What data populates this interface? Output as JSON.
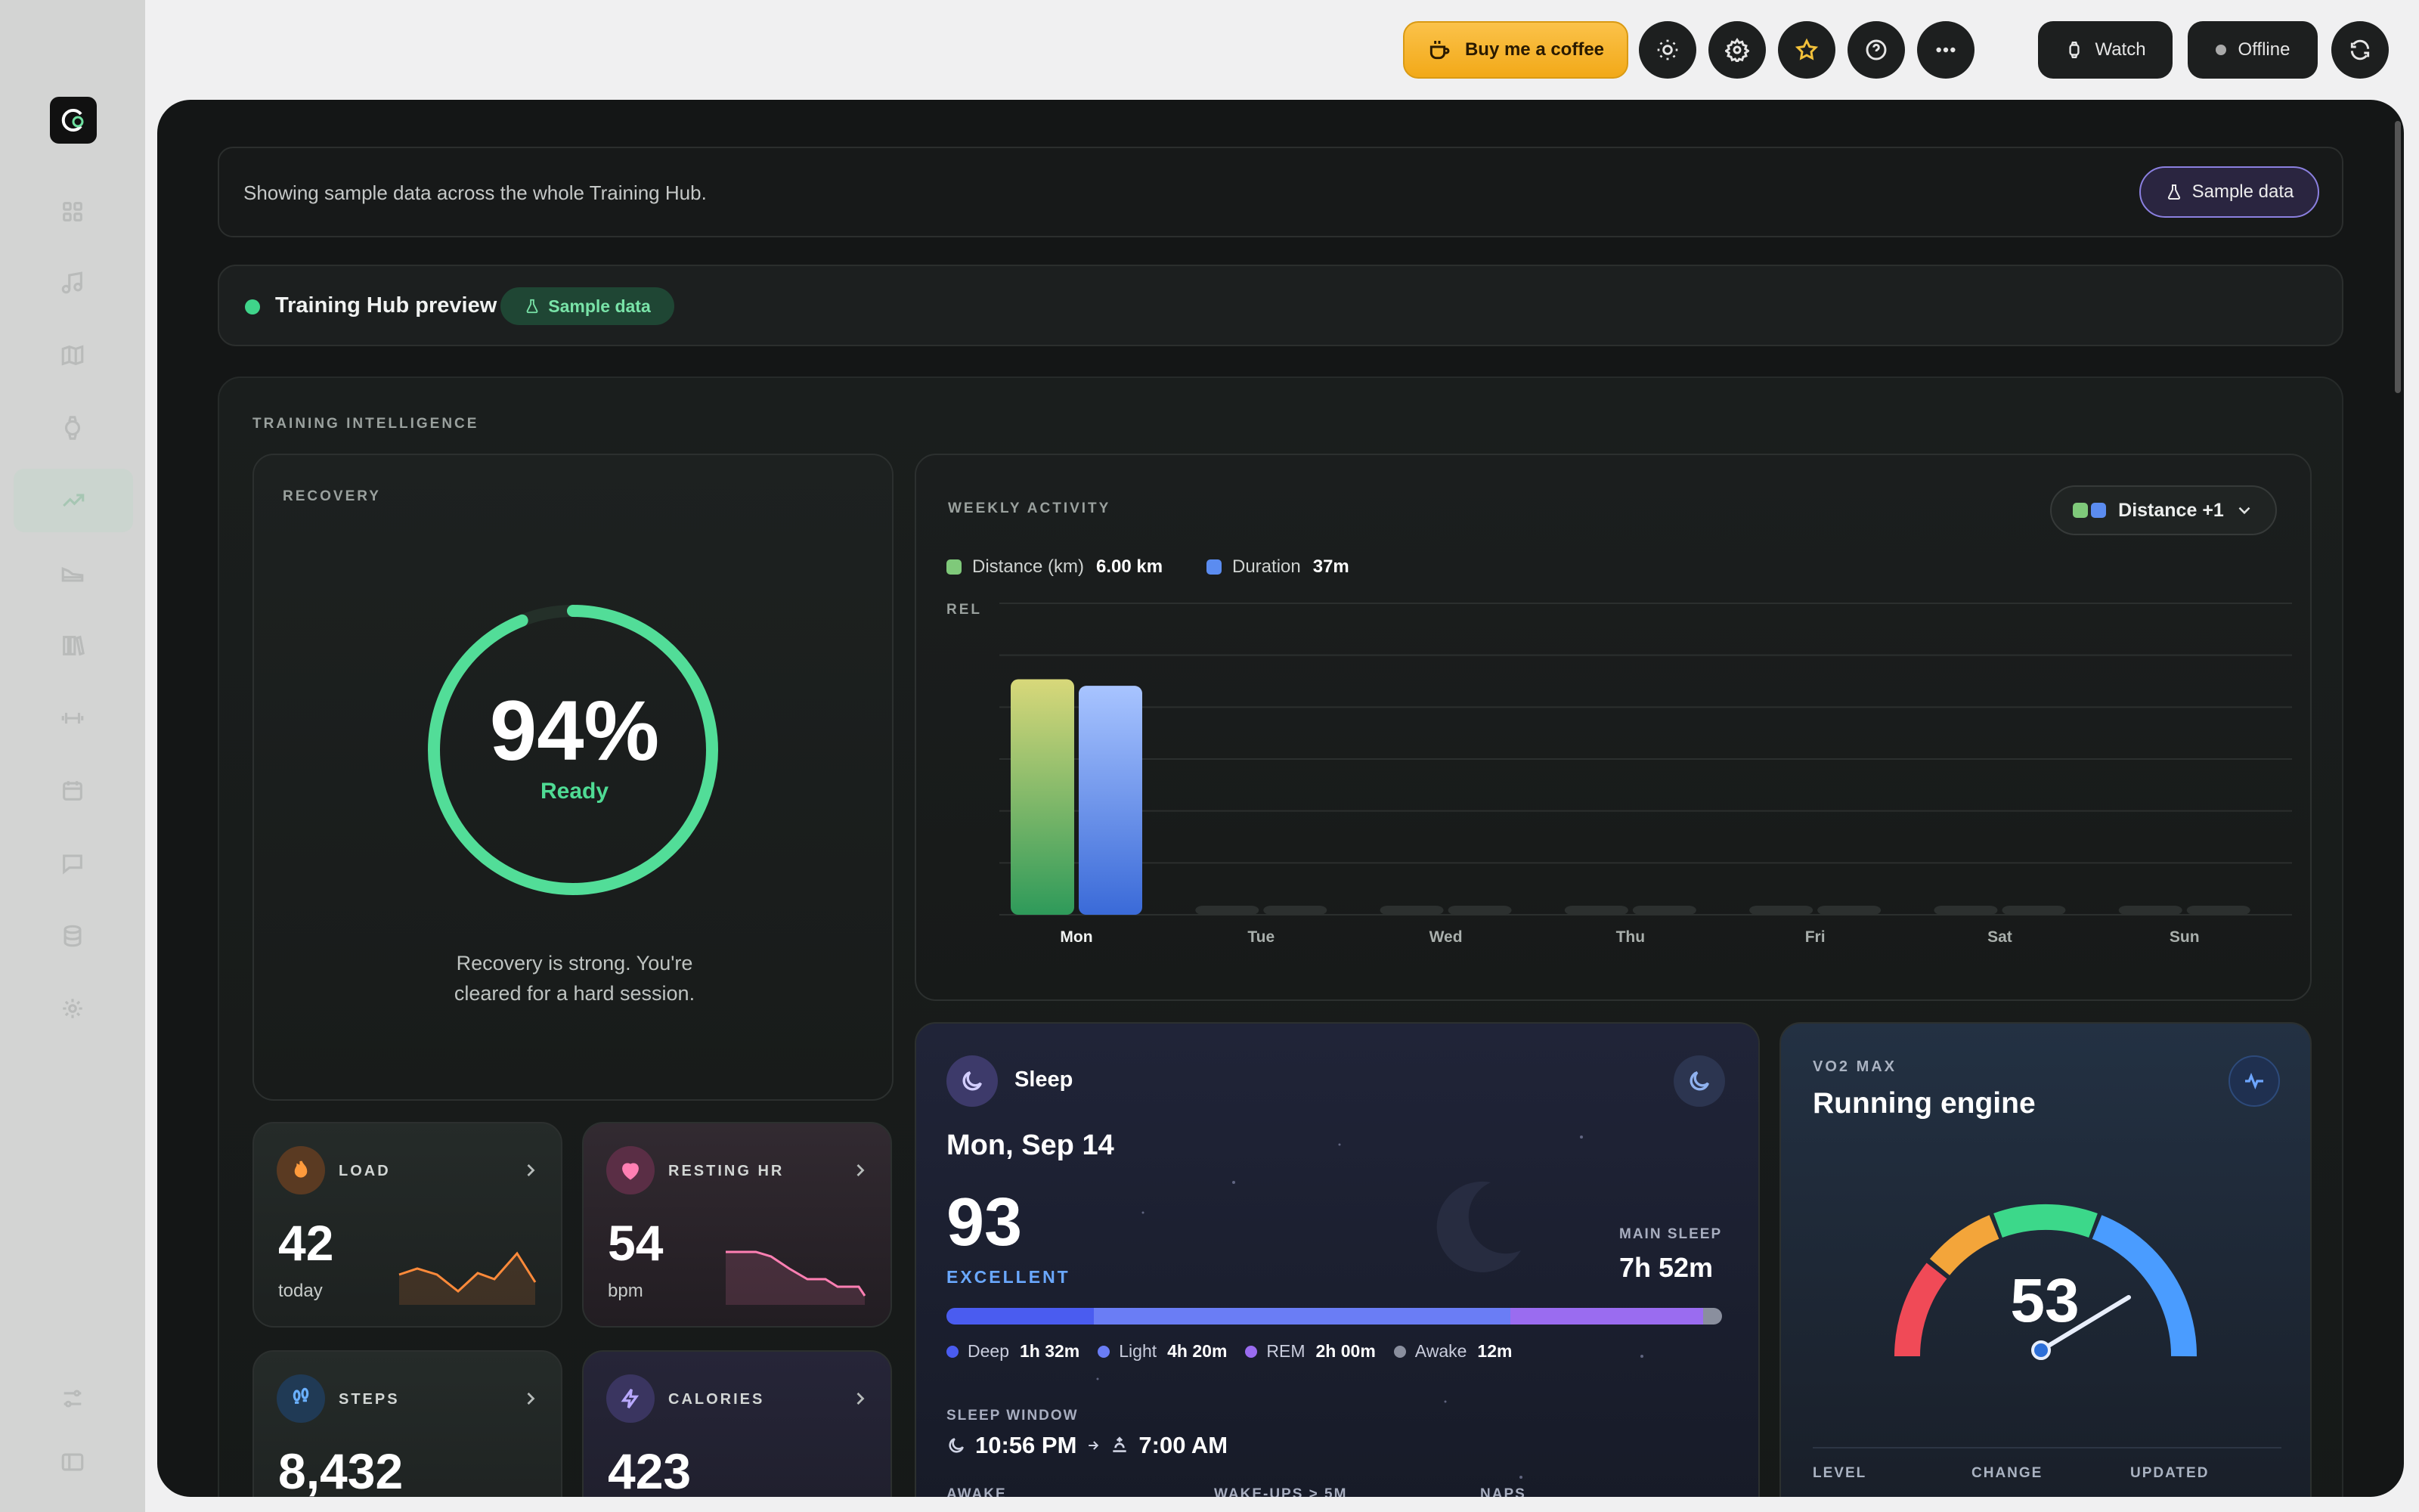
{
  "topbar": {
    "coffee_label": "Buy me a coffee",
    "watch_label": "Watch",
    "offline_label": "Offline"
  },
  "banner": {
    "text": "Showing sample data across the whole Training Hub.",
    "sample_button": "Sample data"
  },
  "preview": {
    "title": "Training Hub preview",
    "badge": "Sample data"
  },
  "intelligence": {
    "label": "TRAINING INTELLIGENCE"
  },
  "recovery": {
    "label": "RECOVERY",
    "percent": "94%",
    "percent_value": 94,
    "status": "Ready",
    "description": "Recovery is strong. You're cleared for a hard session."
  },
  "tiles": {
    "load": {
      "label": "LOAD",
      "value": "42",
      "unit": "today"
    },
    "resting_hr": {
      "label": "RESTING HR",
      "value": "54",
      "unit": "bpm"
    },
    "steps": {
      "label": "STEPS",
      "value": "8,432"
    },
    "calories": {
      "label": "CALORIES",
      "value": "423"
    }
  },
  "weekly": {
    "label": "WEEKLY ACTIVITY",
    "select_label": "Distance +1",
    "legend": [
      {
        "name": "Distance (km)",
        "value": "6.00 km",
        "color": "#7fc97a"
      },
      {
        "name": "Duration",
        "value": "37m",
        "color": "#5b8cf0"
      }
    ]
  },
  "chart_data": {
    "type": "bar",
    "ylabel": "REL",
    "categories": [
      "Mon",
      "Tue",
      "Wed",
      "Thu",
      "Fri",
      "Sat",
      "Sun"
    ],
    "series": [
      {
        "name": "Distance (km)",
        "values": [
          6.0,
          0,
          0,
          0,
          0,
          0,
          0
        ]
      },
      {
        "name": "Duration",
        "values": [
          37,
          0,
          0,
          0,
          0,
          0,
          0
        ]
      }
    ],
    "relative_heights": [
      [
        0.72,
        0,
        0,
        0,
        0,
        0,
        0
      ],
      [
        0.7,
        0,
        0,
        0,
        0,
        0,
        0
      ]
    ],
    "ylim": [
      0,
      1
    ],
    "grid": true
  },
  "sleep": {
    "title": "Sleep",
    "date": "Mon, Sep 14",
    "score": "93",
    "grade": "EXCELLENT",
    "main_sleep_label": "MAIN SLEEP",
    "main_sleep_value": "7h 52m",
    "stages": [
      {
        "name": "Deep",
        "value": "1h 32m",
        "minutes": 92,
        "color": "#4a5cf0"
      },
      {
        "name": "Light",
        "value": "4h 20m",
        "minutes": 260,
        "color": "#6a7df5"
      },
      {
        "name": "REM",
        "value": "2h 00m",
        "minutes": 120,
        "color": "#9a6cf0"
      },
      {
        "name": "Awake",
        "value": "12m",
        "minutes": 12,
        "color": "#8a8f9e"
      }
    ],
    "window_label": "SLEEP WINDOW",
    "bed_time": "10:56 PM",
    "wake_time": "7:00 AM",
    "awake_label": "AWAKE",
    "wakeups_label": "WAKE-UPS > 5M",
    "naps_label": "NAPS"
  },
  "vo2": {
    "label": "VO2 MAX",
    "title": "Running engine",
    "value": "53",
    "level_label": "LEVEL",
    "change_label": "CHANGE",
    "updated_label": "UPDATED"
  }
}
